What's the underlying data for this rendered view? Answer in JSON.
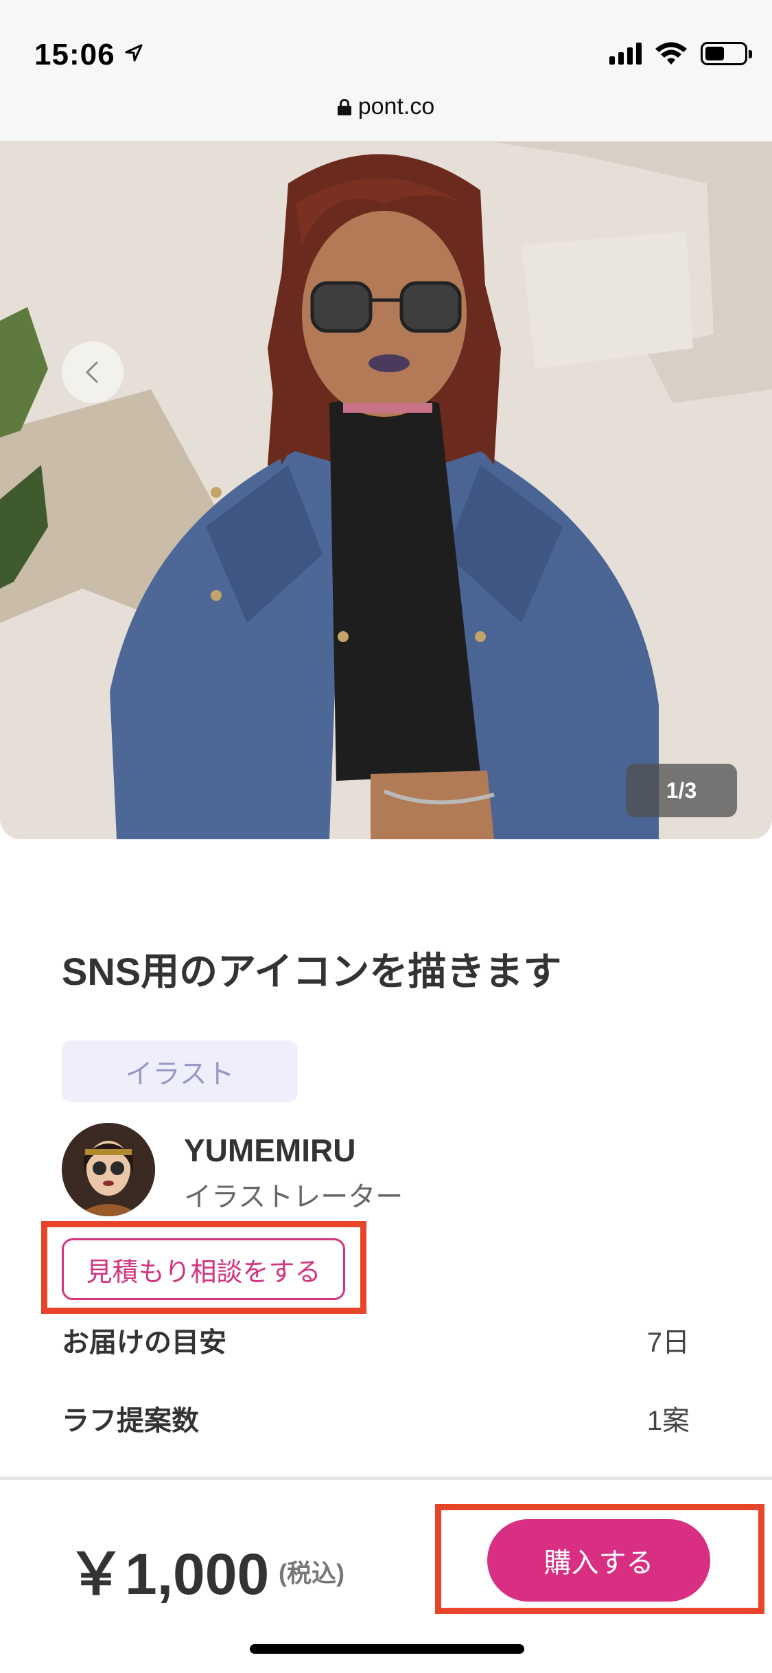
{
  "status_bar": {
    "time": "15:06",
    "icons": [
      "location-arrow-icon",
      "signal-icon",
      "wifi-icon",
      "battery-icon"
    ]
  },
  "browser": {
    "url": "pont.co",
    "url_icon": "lock-icon"
  },
  "gallery": {
    "counter": "1/3",
    "back_icon": "chevron-left-icon"
  },
  "product": {
    "title": "SNS用のアイコンを描きます",
    "category": "イラスト",
    "creator": {
      "name": "YUMEMIRU",
      "role": "イラストレーター"
    },
    "consult_label": "見積もり相談をする",
    "specs": [
      {
        "label": "お届けの目安",
        "value": "7日"
      },
      {
        "label": "ラフ提案数",
        "value": "1案"
      }
    ]
  },
  "purchase": {
    "price": "￥1,000",
    "tax_note": "(税込)",
    "buy_label": "購入する"
  },
  "colors": {
    "accent": "#d82f82",
    "highlight": "#e8442a",
    "tag_bg": "#efeefb",
    "tag_text": "#9b98c6"
  }
}
